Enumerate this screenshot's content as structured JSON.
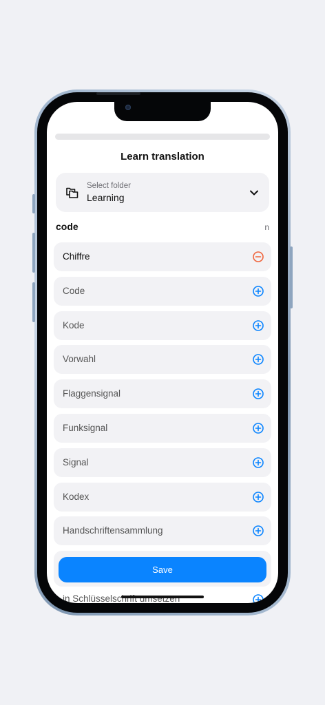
{
  "sheet": {
    "title": "Learn translation",
    "folder_label": "Select folder",
    "folder_value": "Learning"
  },
  "entry": {
    "word": "code",
    "part_of_speech": "n"
  },
  "translations": [
    {
      "label": "Chiffre",
      "state": "selected"
    },
    {
      "label": "Code",
      "state": "add"
    },
    {
      "label": "Kode",
      "state": "add"
    },
    {
      "label": "Vorwahl",
      "state": "add"
    },
    {
      "label": "Flaggensignal",
      "state": "add"
    },
    {
      "label": "Funksignal",
      "state": "add"
    },
    {
      "label": "Signal",
      "state": "add"
    },
    {
      "label": "Kodex",
      "state": "add"
    },
    {
      "label": "Handschriftensammlung",
      "state": "add"
    }
  ],
  "peek_item": "in Schlüsselschrift umsetzen",
  "save_label": "Save",
  "colors": {
    "accent": "#0a84ff",
    "remove": "#f0643c",
    "row_bg": "#f2f2f5",
    "page_bg": "#f0f1f5"
  }
}
